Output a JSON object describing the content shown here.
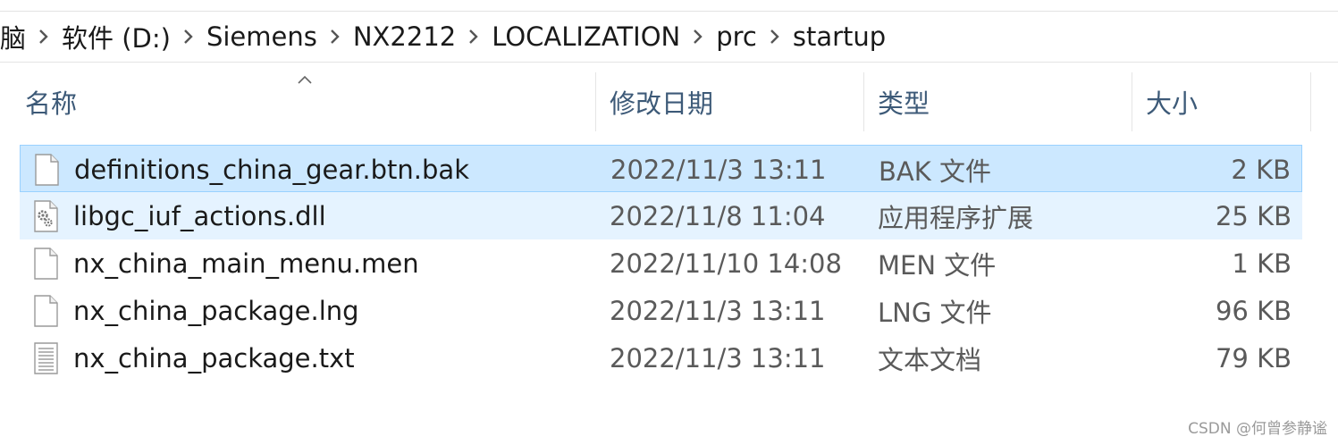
{
  "breadcrumb": {
    "items": [
      "脑",
      "软件 (D:)",
      "Siemens",
      "NX2212",
      "LOCALIZATION",
      "prc",
      "startup"
    ]
  },
  "columns": {
    "name": "名称",
    "date": "修改日期",
    "type": "类型",
    "size": "大小"
  },
  "files": [
    {
      "name": "definitions_china_gear.btn.bak",
      "date": "2022/11/3 13:11",
      "type": "BAK 文件",
      "size": "2 KB",
      "icon": "blank-file-icon",
      "state": "selected"
    },
    {
      "name": "libgc_iuf_actions.dll",
      "date": "2022/11/8 11:04",
      "type": "应用程序扩展",
      "size": "25 KB",
      "icon": "dll-gear-file-icon",
      "state": "hover"
    },
    {
      "name": "nx_china_main_menu.men",
      "date": "2022/11/10 14:08",
      "type": "MEN 文件",
      "size": "1 KB",
      "icon": "blank-file-icon",
      "state": "normal"
    },
    {
      "name": "nx_china_package.lng",
      "date": "2022/11/3 13:11",
      "type": "LNG 文件",
      "size": "96 KB",
      "icon": "blank-file-icon",
      "state": "normal"
    },
    {
      "name": "nx_china_package.txt",
      "date": "2022/11/3 13:11",
      "type": "文本文档",
      "size": "79 KB",
      "icon": "text-file-icon",
      "state": "normal"
    }
  ],
  "watermark": "CSDN @何曾参静谧",
  "colors": {
    "selected_bg": "#cce8ff",
    "selected_border": "#99d1ff",
    "hover_bg": "#e5f3ff",
    "header_text": "#3d5a78"
  }
}
